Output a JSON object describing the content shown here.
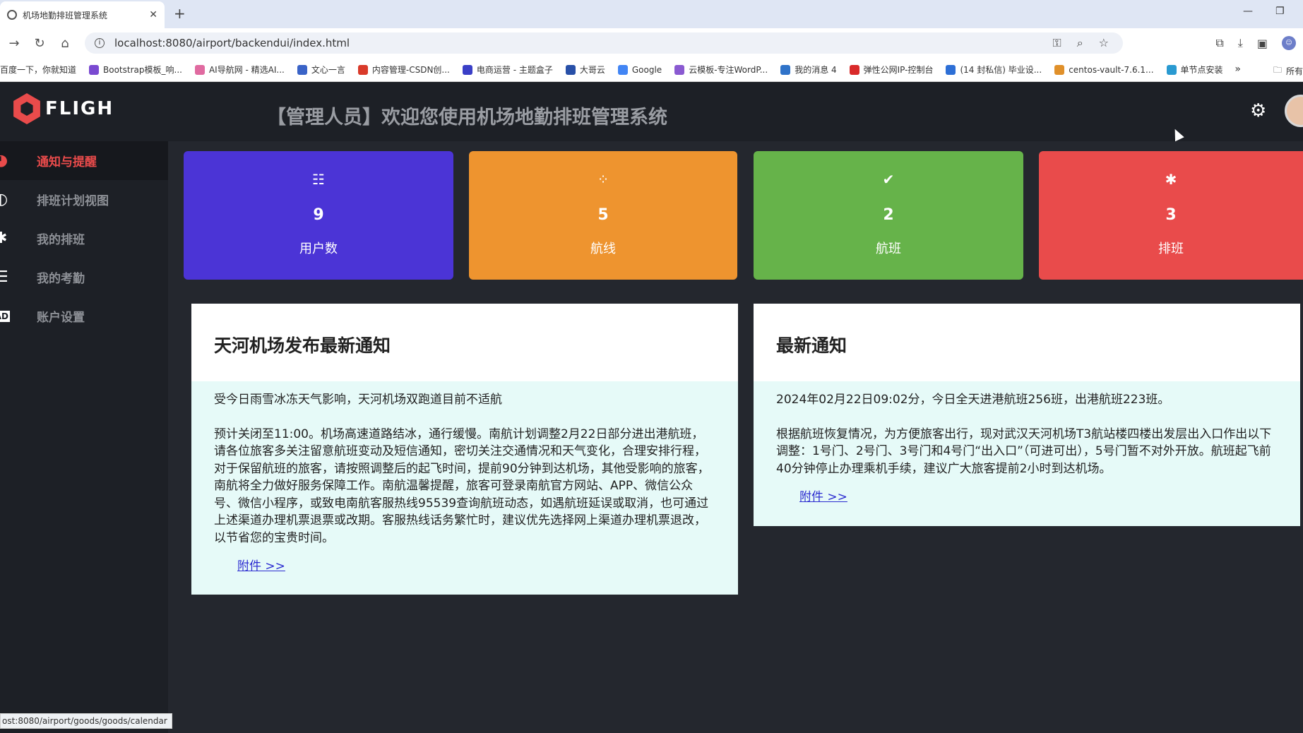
{
  "browser": {
    "tab_title": "机场地勤排班管理系统",
    "url": "localhost:8080/airport/backendui/index.html",
    "bookmarks": [
      "百度一下，你就知道",
      "Bootstrap模板_响...",
      "AI导航网 - 精选AI...",
      "文心一言",
      "内容管理-CSDN创...",
      "电商运营 - 主题盒子",
      "大哥云",
      "Google",
      "云模板-专注WordP...",
      "我的消息 4",
      "弹性公网IP-控制台",
      "(14 封私信) 毕业设...",
      "centos-vault-7.6.1...",
      "单节点安装"
    ],
    "bookmarks_more": "»",
    "bookmarks_all": "所有",
    "status_url": "ost:8080/airport/goods/goods/calendar"
  },
  "colors": {
    "header_bg": "#1d2026",
    "accent_red": "#e94b4b",
    "card_purple": "#4b34d6",
    "card_orange": "#ee942f",
    "card_green": "#66b34a",
    "card_red": "#e94b4b",
    "panel_body_bg": "#e6faf8"
  },
  "header": {
    "logo_text": "FLIGH",
    "title": "【管理人员】欢迎您使用机场地勤排班管理系统"
  },
  "sidebar": {
    "items": [
      {
        "label": "通知与提醒",
        "icon": "dashboard-icon",
        "active": true
      },
      {
        "label": "排班计划视图",
        "icon": "half-circle-icon",
        "active": false
      },
      {
        "label": "我的排班",
        "icon": "bug-icon",
        "active": false
      },
      {
        "label": "我的考勤",
        "icon": "list-icon",
        "active": false
      },
      {
        "label": "账户设置",
        "icon": "ad-icon",
        "active": false
      }
    ]
  },
  "stats": [
    {
      "value": "9",
      "label": "用户数",
      "icon": "list-icon"
    },
    {
      "value": "5",
      "label": "航线",
      "icon": "spinner-icon"
    },
    {
      "value": "2",
      "label": "航班",
      "icon": "check-circle-icon"
    },
    {
      "value": "3",
      "label": "排班",
      "icon": "bug-icon"
    }
  ],
  "panels": {
    "left": {
      "title": "天河机场发布最新通知",
      "para1": "受今日雨雪冰冻天气影响，天河机场双跑道目前不适航",
      "para2": "预计关闭至11:00。机场高速道路结冰，通行缓慢。南航计划调整2月22日部分进出港航班，请各位旅客多关注留意航班变动及短信通知，密切关注交通情况和天气变化，合理安排行程，对于保留航班的旅客，请按照调整后的起飞时间，提前90分钟到达机场，其他受影响的旅客，南航将全力做好服务保障工作。南航温馨提醒，旅客可登录南航官方网站、APP、微信公众号、微信小程序，或致电南航客服热线95539查询航班动态，如遇航班延误或取消，也可通过上述渠道办理机票退票或改期。客服热线话务繁忙时，建议优先选择网上渠道办理机票退改，以节省您的宝贵时间。",
      "attachment": "附件 >>"
    },
    "right": {
      "title": "最新通知",
      "para1": "2024年02月22日09:02分，今日全天进港航班256班，出港航班223班。",
      "para2": "根据航班恢复情况，为方便旅客出行，现对武汉天河机场T3航站楼四楼出发层出入口作出以下调整：1号门、2号门、3号门和4号门“出入口”（可进可出），5号门暂不对外开放。航班起飞前40分钟停止办理乘机手续，建议广大旅客提前2小时到达机场。",
      "attachment": "附件 >>"
    }
  }
}
